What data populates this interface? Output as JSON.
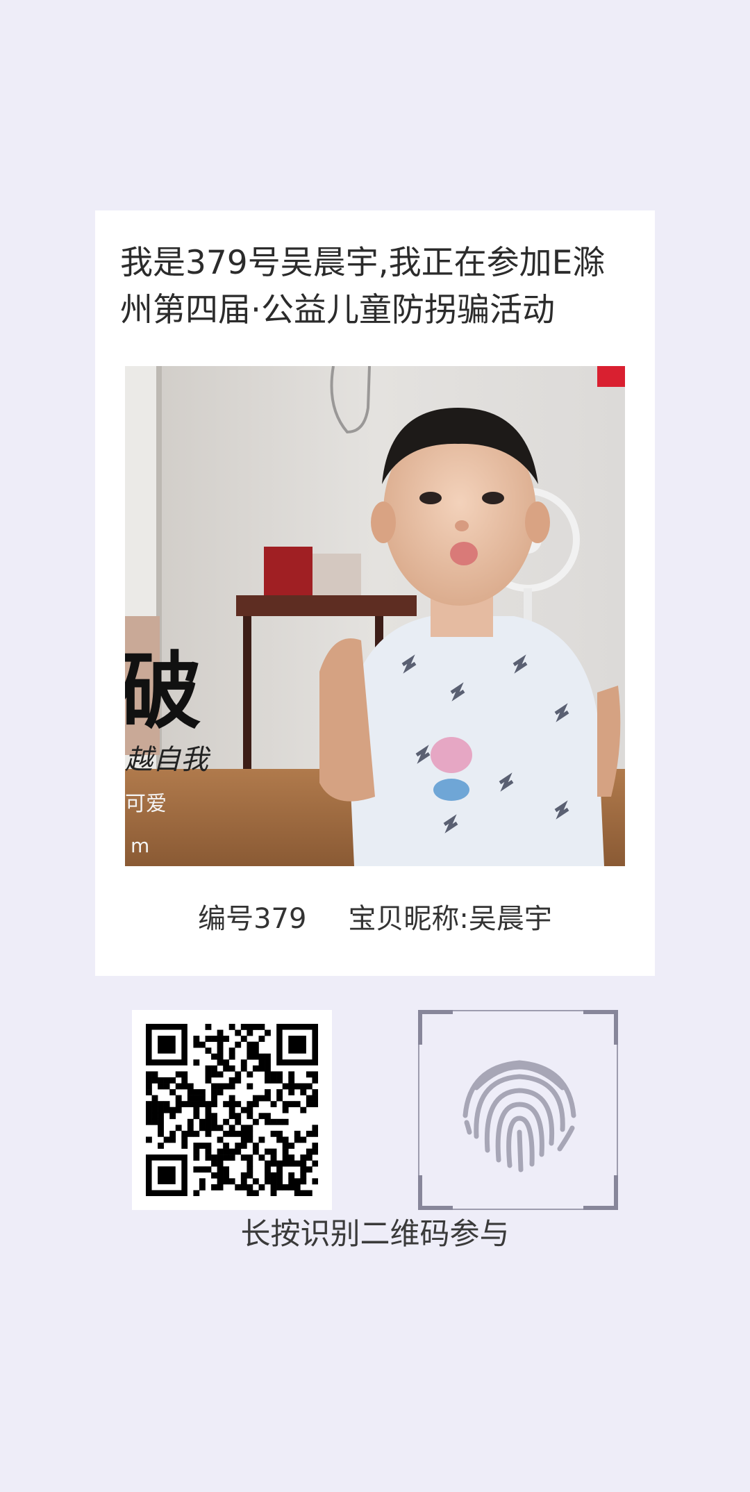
{
  "card": {
    "title": "我是379号吴晨宇,我正在参加E滁州第四届·公益儿童防拐骗活动",
    "photo": {
      "alt": "photo-of-child",
      "overlay_text_1": "破",
      "overlay_text_2": "越自我",
      "overlay_text_3": "可爱",
      "overlay_text_4": "m"
    },
    "number_label": "编号379",
    "nickname_label": "宝贝昵称:",
    "nickname_value": "吴晨宇"
  },
  "qr": {
    "icon": "qr-code-icon"
  },
  "fingerprint": {
    "icon": "fingerprint-icon"
  },
  "hint": "长按识别二维码参与",
  "colors": {
    "background": "#eeedf8",
    "card": "#ffffff",
    "fingerprint": "#a7a6b6"
  }
}
